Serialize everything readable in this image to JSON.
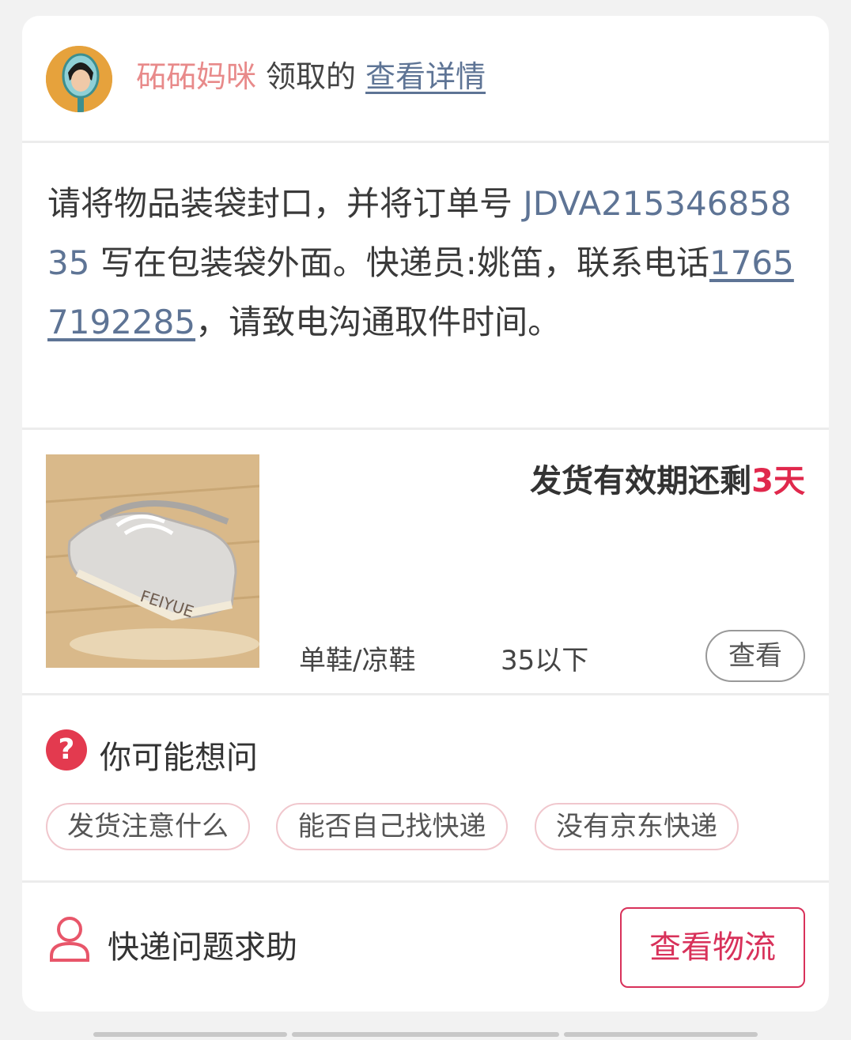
{
  "header": {
    "nickname": "砳砳妈咪",
    "verb": "领取的",
    "detail_link": "查看详情"
  },
  "instruction": {
    "prefix": "请将物品装袋封口，并将订单号 ",
    "order_no": "JDVA21534685835",
    "middle": " 写在包装袋外面。快递员:姚笛，联系电话",
    "phone": "17657192285",
    "suffix": "，请致电沟通取件时间。"
  },
  "item": {
    "deadline_prefix": "发货有效期还剩",
    "deadline_days": "3天",
    "category": "单鞋/凉鞋",
    "size": "35以下",
    "view_button": "查看",
    "photo_text": "FEIYUE"
  },
  "faq": {
    "icon": "question-icon",
    "title": "你可能想问",
    "chips": [
      "发货注意什么",
      "能否自己找快递",
      "没有京东快递"
    ]
  },
  "bottom": {
    "icon": "person-icon",
    "help_label": "快递问题求助",
    "logistics_button": "查看物流"
  },
  "colors": {
    "accent_red": "#d8315a",
    "link_blue": "#5e7495",
    "nickname_pink": "#e88a8a"
  }
}
